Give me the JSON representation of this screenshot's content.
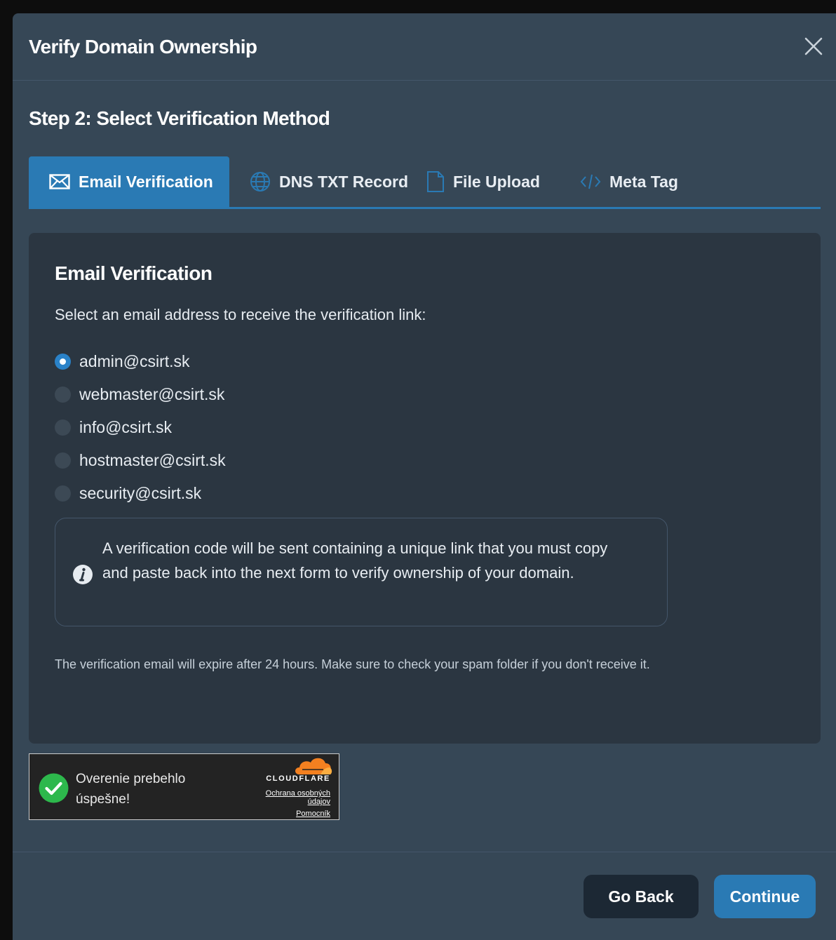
{
  "modal": {
    "title": "Verify Domain Ownership",
    "close_icon": "close-icon",
    "step_title": "Step 2: Select Verification Method"
  },
  "tabs": [
    {
      "label": "Email Verification",
      "icon": "envelope-icon",
      "active": true
    },
    {
      "label": "DNS TXT Record",
      "icon": "globe-icon",
      "active": false
    },
    {
      "label": "File Upload",
      "icon": "file-icon",
      "active": false
    },
    {
      "label": "Meta Tag",
      "icon": "code-icon",
      "active": false
    }
  ],
  "panel": {
    "title": "Email Verification",
    "description": "Select an email address to receive the verification link:",
    "options": [
      {
        "label": "admin@csirt.sk",
        "selected": true
      },
      {
        "label": "webmaster@csirt.sk",
        "selected": false
      },
      {
        "label": "info@csirt.sk",
        "selected": false
      },
      {
        "label": "hostmaster@csirt.sk",
        "selected": false
      },
      {
        "label": "security@csirt.sk",
        "selected": false
      }
    ],
    "info_text": "A verification code will be sent containing a unique link that you must copy and paste back into the next form to verify ownership of your domain.",
    "note": "The verification email will expire after 24 hours. Make sure to check your spam folder if you don't receive it."
  },
  "captcha": {
    "status_text": "Overenie prebehlo úspešne!",
    "brand": "CLOUDFLARE",
    "privacy_link": "Ochrana osobných údajov",
    "help_link": "Pomocník"
  },
  "footer": {
    "back_label": "Go Back",
    "continue_label": "Continue"
  },
  "colors": {
    "accent": "#2a7ab4",
    "modal_bg": "#364756",
    "panel_bg": "#2b3641",
    "success": "#2db84c",
    "cloudflare_orange": "#f38020"
  }
}
